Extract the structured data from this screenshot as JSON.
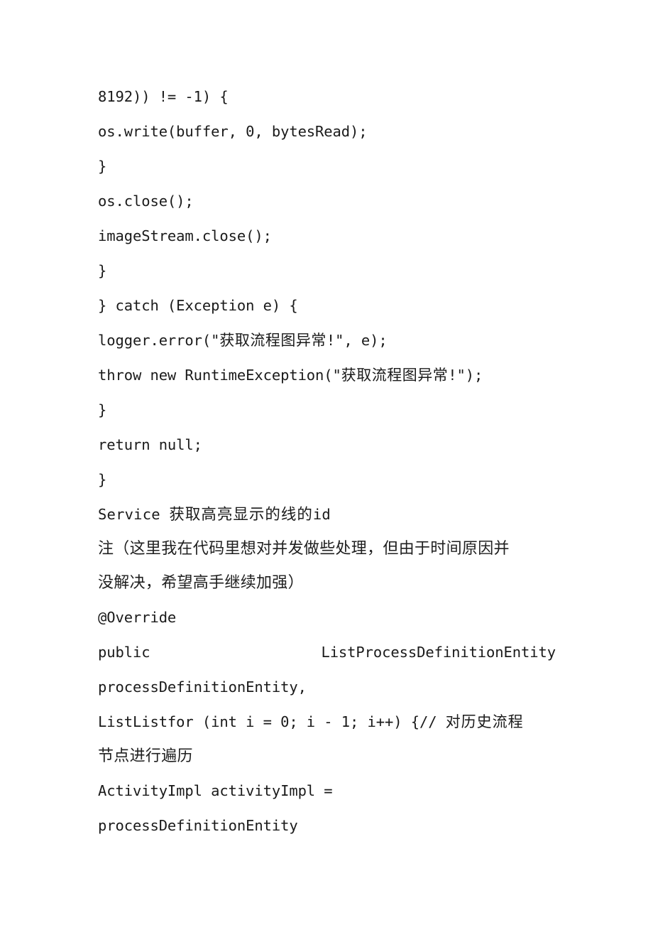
{
  "document": {
    "page_background": "#ffffff",
    "text_color": "#1a1a1a",
    "blocks": [
      {
        "id": "l1",
        "kind": "code",
        "text": "8192)) != -1) {"
      },
      {
        "id": "l2",
        "kind": "code",
        "text": "os.write(buffer, 0, bytesRead);"
      },
      {
        "id": "l3",
        "kind": "code",
        "text": "}"
      },
      {
        "id": "l4",
        "kind": "code",
        "text": "os.close();"
      },
      {
        "id": "l5",
        "kind": "code",
        "text": "imageStream.close();"
      },
      {
        "id": "l6",
        "kind": "code",
        "text": "}"
      },
      {
        "id": "l7",
        "kind": "code",
        "text": "} catch (Exception e) {"
      },
      {
        "id": "l8",
        "kind": "code-cjk",
        "prefix": "logger.error(\"",
        "cjk": "获取流程图异常",
        "suffix": "!\", e);"
      },
      {
        "id": "l9",
        "kind": "code-cjk",
        "prefix": "throw new RuntimeException(\"",
        "cjk": "获取流程图异常",
        "suffix": "!\");"
      },
      {
        "id": "l10",
        "kind": "code",
        "text": "}"
      },
      {
        "id": "l11",
        "kind": "code",
        "text": "return null;"
      },
      {
        "id": "l12",
        "kind": "code",
        "text": "}"
      },
      {
        "id": "l13",
        "kind": "service",
        "prefix": "Service ",
        "cjk": "获取高亮显示的线的",
        "suffix": "id"
      },
      {
        "id": "l14",
        "kind": "prose",
        "line1": "注（这里我在代码里想对并发做些处理，但由于时间原因并",
        "line2": "没解决，希望高手继续加强）"
      },
      {
        "id": "l15",
        "kind": "code",
        "text": "@Override"
      },
      {
        "id": "l16",
        "kind": "spread",
        "left": "public",
        "right": "ListProcessDefinitionEntity"
      },
      {
        "id": "l17",
        "kind": "code",
        "text": "processDefinitionEntity,"
      },
      {
        "id": "l18",
        "kind": "mix",
        "latin": "ListListfor (int i = 0; i - 1; i++) {// ",
        "cjk": "对历史流程"
      },
      {
        "id": "l19",
        "kind": "prose-cont",
        "text": "节点进行遍历"
      },
      {
        "id": "l20",
        "kind": "code",
        "text": "ActivityImpl activityImpl ="
      },
      {
        "id": "l21",
        "kind": "code",
        "text": "processDefinitionEntity"
      }
    ]
  }
}
